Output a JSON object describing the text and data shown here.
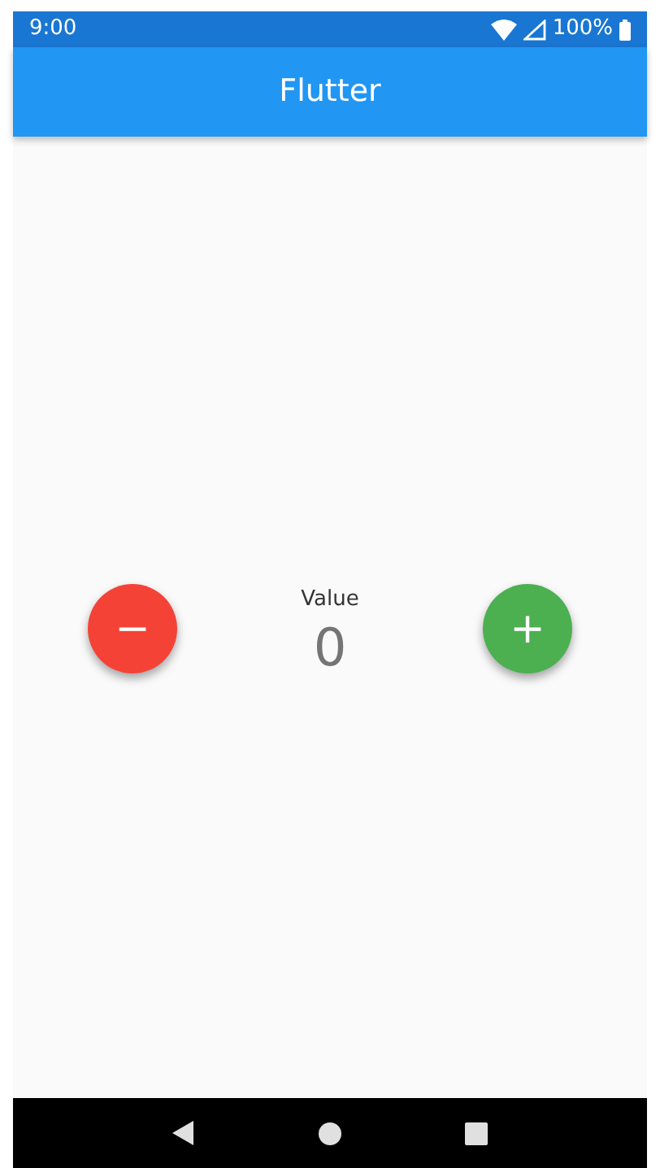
{
  "status_bar": {
    "time": "9:00",
    "battery": "100%"
  },
  "app_bar": {
    "title": "Flutter"
  },
  "counter": {
    "label": "Value",
    "value": "0"
  },
  "buttons": [
    {
      "kind": "decrement",
      "symbol": "−"
    },
    {
      "kind": "increment",
      "symbol": "+"
    }
  ]
}
